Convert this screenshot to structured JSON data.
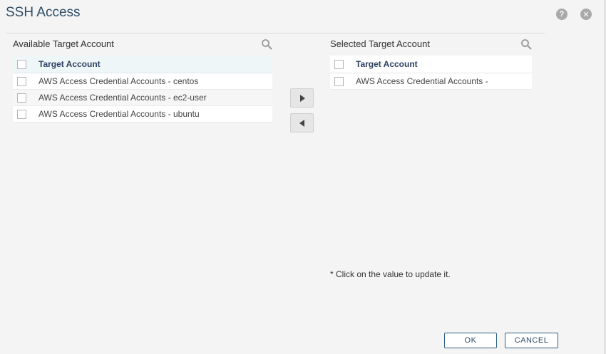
{
  "dialog": {
    "title": "SSH Access",
    "help_icon": "help-icon",
    "close_icon": "close-icon"
  },
  "available": {
    "title": "Available Target Account",
    "column_header": "Target Account",
    "rows": [
      "AWS Access Credential Accounts - centos",
      "AWS Access Credential Accounts - ec2-user",
      "AWS Access Credential Accounts - ubuntu"
    ]
  },
  "selected": {
    "title": "Selected Target Account",
    "column_header": "Target Account",
    "rows": [
      "AWS Access Credential Accounts -"
    ]
  },
  "transfer": {
    "add_icon": "arrow-right-icon",
    "remove_icon": "arrow-left-icon"
  },
  "note": "* Click on the value to update it.",
  "buttons": {
    "ok": "OK",
    "cancel": "CANCEL"
  },
  "colors": {
    "accent": "#2d5f84",
    "title": "#2d4d66",
    "header_bg": "#eef6f8"
  }
}
